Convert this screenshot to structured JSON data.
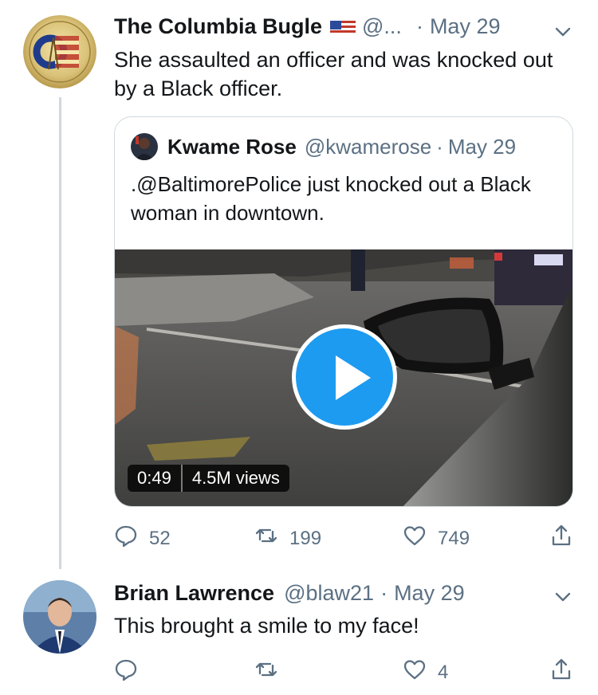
{
  "tweets": [
    {
      "name": "The Columbia Bugle",
      "handle": "@...",
      "dot": "·",
      "date": "May 29",
      "text": "She assaulted an officer and was knocked out by a Black officer.",
      "flag_icon": "us-flag-icon",
      "quote": {
        "name": "Kwame Rose",
        "handle": "@kwamerose",
        "dot": "·",
        "date": "May 29",
        "text": ".@BaltimorePolice just knocked out a Black woman in downtown.",
        "video_duration": "0:49",
        "video_views": "4.5M views"
      },
      "actions": {
        "replies": "52",
        "retweets": "199",
        "likes": "749",
        "share": ""
      }
    },
    {
      "name": "Brian Lawrence",
      "handle": "@blaw21",
      "dot": "·",
      "date": "May 29",
      "text": "This brought a smile to my face!",
      "actions": {
        "replies": "",
        "retweets": "",
        "likes": "4",
        "share": ""
      }
    }
  ],
  "colors": {
    "accent": "#1d9bf0",
    "secondary_text": "#5b7083",
    "border": "#cfd9de"
  },
  "icons": [
    "reply-icon",
    "retweet-icon",
    "like-icon",
    "share-icon",
    "chevron-down-icon",
    "play-icon"
  ]
}
